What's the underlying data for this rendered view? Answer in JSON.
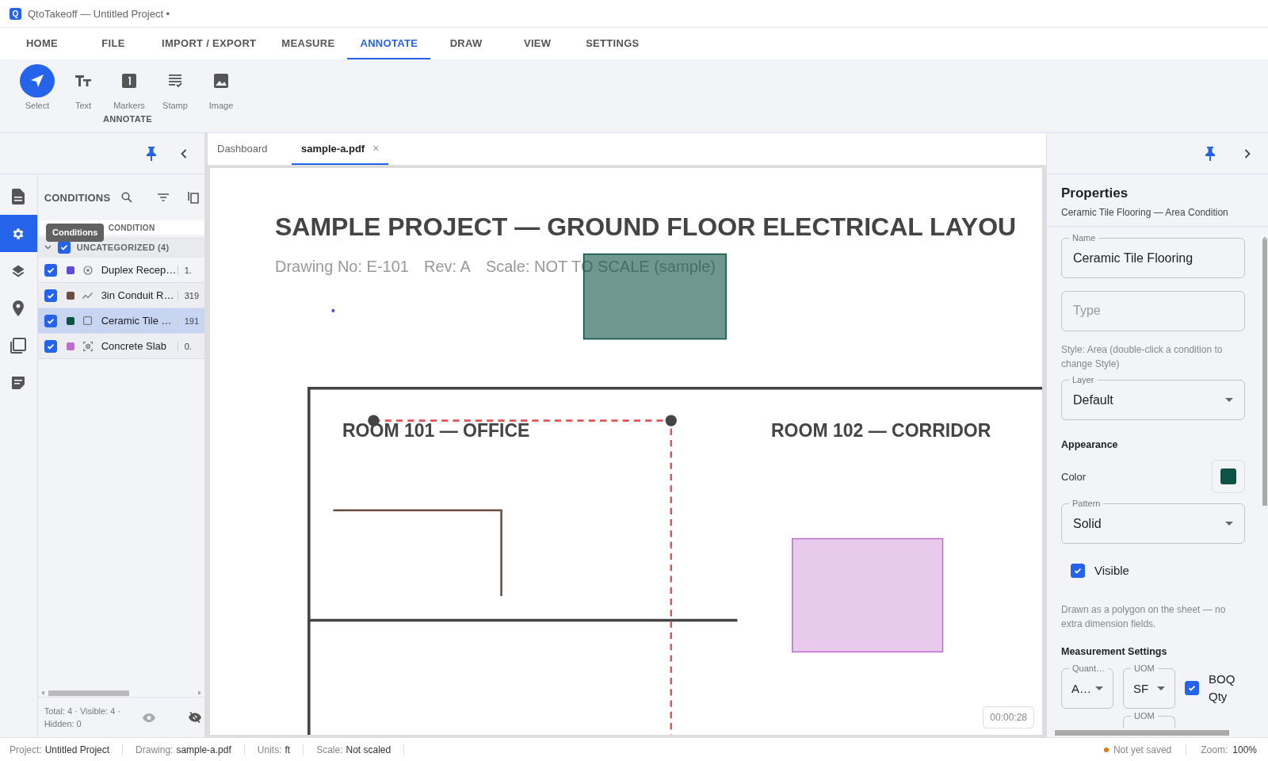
{
  "window": {
    "app_icon": "Q",
    "title": "QtoTakeoff — Untitled Project •"
  },
  "menu_tabs": [
    {
      "label": "HOME",
      "selected": false
    },
    {
      "label": "FILE",
      "selected": false
    },
    {
      "label": "IMPORT / EXPORT",
      "selected": false
    },
    {
      "label": "MEASURE",
      "selected": false
    },
    {
      "label": "ANNOTATE",
      "selected": true
    },
    {
      "label": "DRAW",
      "selected": false
    },
    {
      "label": "VIEW",
      "selected": false
    },
    {
      "label": "SETTINGS",
      "selected": false
    }
  ],
  "ribbon": {
    "tools": [
      {
        "kind": "select",
        "label": "Select",
        "selected": true
      },
      {
        "kind": "text",
        "label": "Text",
        "selected": false
      },
      {
        "kind": "marker",
        "label": "Markers",
        "selected": false
      },
      {
        "kind": "stamp",
        "label": "Stamp",
        "selected": false
      },
      {
        "kind": "image",
        "label": "Image",
        "selected": false
      }
    ],
    "group_label": "ANNOTATE"
  },
  "left_rail": [
    {
      "kind": "document",
      "selected": false
    },
    {
      "kind": "conditions",
      "selected": true
    },
    {
      "kind": "layers",
      "selected": false
    },
    {
      "kind": "location",
      "selected": false
    },
    {
      "kind": "pages",
      "selected": false
    },
    {
      "kind": "notes",
      "selected": false
    }
  ],
  "tooltip": "Conditions",
  "conditions": {
    "title": "CONDITIONS",
    "column": "CONDITION",
    "group": {
      "label": "UNCATEGORIZED (4)",
      "expanded": true,
      "checked": true
    },
    "rows": [
      {
        "kind": "count",
        "name": "Duplex Recep…",
        "value": "1.",
        "checked": true,
        "color": "#5b4fd9",
        "selected": false
      },
      {
        "kind": "linear",
        "name": "3in Conduit R…",
        "value": "319",
        "checked": true,
        "color": "#6d4c41",
        "selected": false
      },
      {
        "kind": "area",
        "name": "Ceramic Tile …",
        "value": "191",
        "checked": true,
        "color": "#0d5244",
        "selected": true
      },
      {
        "kind": "volume",
        "name": "Concrete Slab",
        "value": "0.",
        "checked": true,
        "color": "#c06bd0",
        "selected": false
      }
    ],
    "footer": "Total: 4 · Visible: 4 · Hidden: 0"
  },
  "doc_tabs": [
    {
      "label": "Dashboard",
      "selected": false
    },
    {
      "label": "sample-a.pdf",
      "selected": true,
      "close": "×"
    }
  ],
  "sheet": {
    "title": "SAMPLE PROJECT — GROUND FLOOR ELECTRICAL LAYOU",
    "info": [
      "Drawing No: E-101",
      "Rev: A",
      "Scale: NOT TO SCALE (sample)"
    ],
    "rooms": [
      "ROOM 101 — OFFICE",
      "ROOM 102 — CORRIDOR"
    ],
    "timer": "00:00:28"
  },
  "properties": {
    "title": "Properties",
    "subtitle": "Ceramic Tile Flooring — Area Condition",
    "name": {
      "label": "Name",
      "value": "Ceramic Tile Flooring"
    },
    "type": {
      "placeholder": "Type"
    },
    "style_note": "Style: Area (double-click a condition to change Style)",
    "layer": {
      "label": "Layer",
      "value": "Default"
    },
    "appearance": "Appearance",
    "color_label": "Color",
    "color": "#0d5244",
    "pattern": {
      "label": "Pattern",
      "value": "Solid"
    },
    "visible": {
      "label": "Visible",
      "checked": true
    },
    "note": "Drawn as a polygon on the sheet — no extra dimension fields.",
    "measurement": {
      "title": "Measurement Settings",
      "quantity": {
        "label": "Quant…",
        "value": "A…"
      },
      "uom": {
        "label": "UOM",
        "value": "SF"
      },
      "boq": {
        "label": "BOQ Qty",
        "checked": true
      },
      "uom2_label": "UOM"
    }
  },
  "status_bar": {
    "items": [
      {
        "label": "Project:",
        "value": "Untitled Project"
      },
      {
        "label": "Drawing:",
        "value": "sample-a.pdf"
      },
      {
        "label": "Units:",
        "value": "ft"
      },
      {
        "label": "Scale:",
        "value": "Not scaled"
      }
    ],
    "save": {
      "label": "Not yet saved",
      "saved": false
    },
    "zoom": {
      "label": "Zoom:",
      "value": "100%"
    }
  }
}
